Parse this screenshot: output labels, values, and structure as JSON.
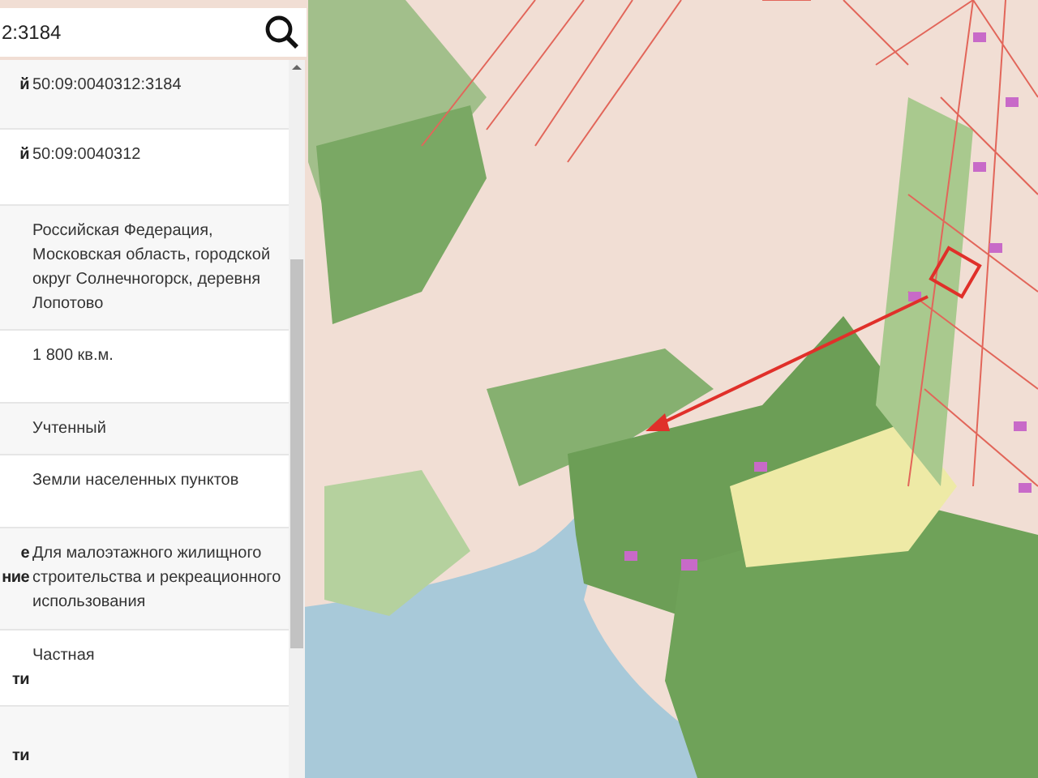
{
  "search": {
    "value": "2:3184"
  },
  "rows": [
    {
      "label": "й",
      "value": "50:09:0040312:3184"
    },
    {
      "label": "й",
      "value": "50:09:0040312"
    },
    {
      "label": "",
      "value": "Российская Федерация, Московская область, городской округ Солнечногорск, деревня Лопотово"
    },
    {
      "label": "",
      "value": "1 800 кв.м."
    },
    {
      "label": "",
      "value": "Учтенный"
    },
    {
      "label": "",
      "value": "Земли населенных пунктов"
    },
    {
      "label": "е\nние",
      "value": "Для малоэтажного жилищного строительства и рекреационного использования"
    },
    {
      "label": "\nти",
      "value": "Частная"
    },
    {
      "label": "\nти",
      "value": ""
    }
  ]
}
